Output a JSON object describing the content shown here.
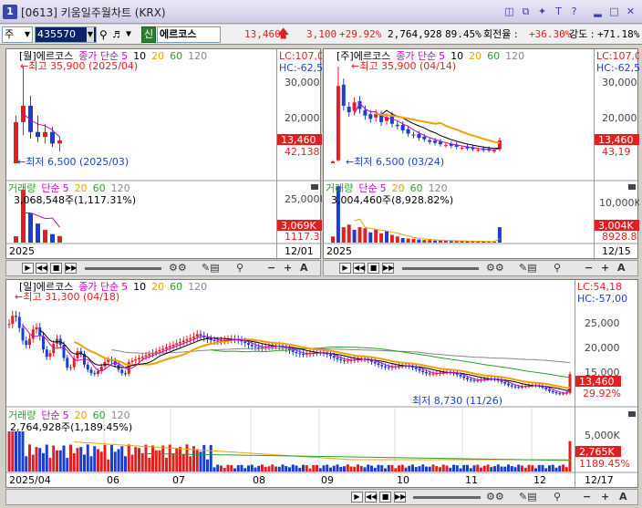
{
  "window": {
    "number": "1",
    "title": "[0613] 키움일주월차트 (KRX)"
  },
  "title_icons": [
    "search-icon",
    "window-icon",
    "pin-icon",
    "text-icon",
    "help-icon",
    "minimize-icon",
    "maximize-icon",
    "close-icon"
  ],
  "toolbar": {
    "period": "주",
    "code": "435570",
    "badge": "신",
    "name": "에르코스",
    "price": "13,460",
    "change": "3,100",
    "rate": "+29.92%",
    "volume": "2,764,928",
    "vol_ratio": "89.45%",
    "turnover_label": "회전율 :",
    "turnover": "+36.30%",
    "strength_label": "강도 :",
    "strength": "+71.18%"
  },
  "colors": {
    "up": "#e02020",
    "down": "#1a3fd0",
    "ma5": "#cc00cc",
    "ma10": "#000000",
    "ma20": "#f0a000",
    "ma60": "#2e9e2e",
    "ma120": "#888888"
  },
  "monthly": {
    "header": {
      "period": "[월]",
      "name": "에르코스",
      "ma_label": "종가 단순",
      "ma5": "5",
      "ma10": "10",
      "ma20": "20",
      "ma60": "60",
      "ma120": "120"
    },
    "high_label": "←최고 35,900 (2025/04)",
    "low_label": "←최저 6,500 (2025/03)",
    "axis": [
      "30,000",
      "20,000"
    ],
    "lc": "LC:107,0",
    "hc": "HC:-62,5",
    "price_tag": "13,460",
    "price_tag2": "42,138",
    "vol_header": {
      "label": "거래량",
      "ma_label": "단순",
      "ma5": "5",
      "ma20": "20",
      "ma60": "60",
      "ma120": "120"
    },
    "vol_value": "3,068,548주(1,117.31%)",
    "vol_axis": "25,000K",
    "vol_tag": "3,069K",
    "vol_tag2": "1117.3",
    "x_label": "2025",
    "date": "12/01",
    "candles": [
      [
        6500,
        21000,
        6500,
        19000
      ],
      [
        19000,
        35900,
        15000,
        24000
      ],
      [
        24000,
        27000,
        14000,
        16000
      ],
      [
        16000,
        21000,
        13000,
        14500
      ],
      [
        14500,
        18500,
        12500,
        16000
      ],
      [
        16000,
        17500,
        11500,
        12500
      ],
      [
        12500,
        14500,
        10000,
        13460
      ]
    ],
    "volumes": [
      3,
      25,
      14,
      9,
      6,
      4,
      3.1
    ]
  },
  "weekly": {
    "header": {
      "period": "[주]",
      "name": "에르코스",
      "ma_label": "종가 단순",
      "ma5": "5",
      "ma10": "10",
      "ma20": "20",
      "ma60": "60",
      "ma120": "120"
    },
    "high_label": "←최고 35,900 (04/14)",
    "low_label": "←최저 6,500 (03/24)",
    "axis": [
      "30,000",
      "20,000"
    ],
    "lc": "LC:107,0",
    "hc": "HC:-62,5",
    "price_tag": "13,460",
    "price_tag2": "43,19",
    "vol_header": {
      "label": "거래량",
      "ma_label": "단순",
      "ma5": "5",
      "ma20": "20",
      "ma60": "60",
      "ma120": "120"
    },
    "vol_value": "3,004,460주(8,928.82%)",
    "vol_axis": "10,000K",
    "vol_tag": "3,004K",
    "vol_tag2": "8928.8",
    "x_label": "2025",
    "date": "12/15",
    "closes": [
      7000,
      30000,
      24000,
      22000,
      25000,
      23000,
      21000,
      20000,
      21500,
      19000,
      20500,
      18500,
      17800,
      16500,
      15500,
      15000,
      14200,
      13800,
      13000,
      12700,
      12300,
      12000,
      11800,
      11500,
      11200,
      11000,
      10800,
      10600,
      10500,
      10400,
      10350,
      13460
    ],
    "volumes": [
      1.2,
      11,
      3,
      3.5,
      2.5,
      3,
      2.8,
      2,
      2.6,
      1.8,
      2.2,
      1.5,
      1.2,
      0.9,
      0.8,
      0.7,
      0.6,
      0.5,
      0.5,
      0.4,
      0.4,
      0.35,
      0.3,
      0.3,
      0.3,
      0.25,
      0.25,
      0.25,
      0.2,
      0.2,
      0.2,
      3
    ]
  },
  "daily": {
    "header": {
      "period": "[일]",
      "name": "에르코스",
      "ma_label": "종가 단순",
      "ma5": "5",
      "ma10": "10",
      "ma20": "20",
      "ma60": "60",
      "ma120": "120"
    },
    "high_label": "←최고 31,300 (04/18)",
    "low_label": "최저 8,730 (11/26)",
    "axis": [
      "25,000",
      "20,000",
      "15,000"
    ],
    "lc": "LC:54,18",
    "hc": "HC:-57,00",
    "price_tag": "13,460",
    "price_tag2": "29.92%",
    "vol_header": {
      "label": "거래량",
      "ma_label": "단순",
      "ma5": "5",
      "ma20": "20",
      "ma60": "60",
      "ma120": "120"
    },
    "vol_value": "2,764,928주(1,189.45%)",
    "vol_axis": "5,000K",
    "vol_tag": "2,765K",
    "vol_tag2": "1189.45%",
    "x_labels": [
      "2025/04",
      "06",
      "07",
      "08",
      "09",
      "10",
      "11",
      "12"
    ],
    "date": "12/17"
  }
}
